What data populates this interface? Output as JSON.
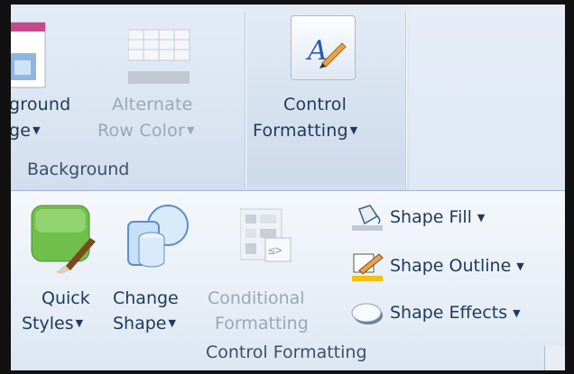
{
  "background_group": {
    "image_button": {
      "line1": "ground",
      "line2": "ge"
    },
    "alternate_row_color": {
      "line1": "Alternate",
      "line2": "Row Color"
    },
    "group_label": "Background"
  },
  "control_formatting_top": {
    "button": {
      "line1": "Control",
      "line2": "Formatting"
    }
  },
  "control_formatting_group": {
    "quick_styles": {
      "line1": "Quick",
      "line2": "Styles"
    },
    "change_shape": {
      "line1": "Change",
      "line2": "Shape"
    },
    "conditional_formatting": {
      "line1": "Conditional",
      "line2": "Formatting"
    },
    "shape_fill": "Shape Fill",
    "shape_outline": "Shape Outline",
    "shape_effects": "Shape Effects",
    "group_label": "Control Formatting"
  },
  "dropdown_arrow": "▼",
  "colors": {
    "accent_green": "#6fbf4a",
    "outline_yellow": "#f4c10f",
    "disabled_text": "#9aa7b6"
  }
}
